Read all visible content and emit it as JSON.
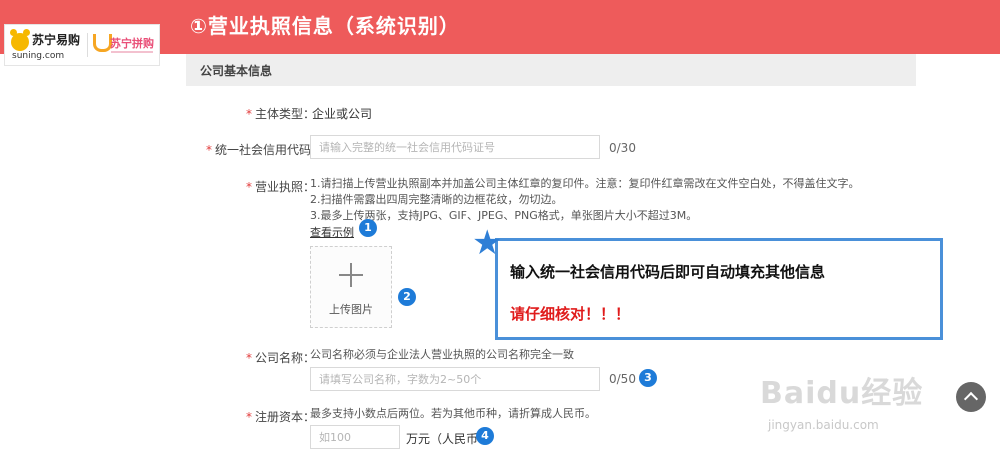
{
  "banner": {
    "title": "①营业执照信息（系统识别）"
  },
  "logos": {
    "suning": "苏宁易购",
    "suning_sub": "suning.com",
    "pinggou": "苏宁拼购"
  },
  "section": {
    "title": "公司基本信息"
  },
  "fields": {
    "entity_type": {
      "label": "主体类型：",
      "value": "企业或公司"
    },
    "credit_code": {
      "label": "统一社会信用代码",
      "placeholder": "请输入完整的统一社会信用代码证号",
      "counter": "0/30"
    },
    "license": {
      "label": "营业执照：",
      "hints": [
        "1.请扫描上传营业执照副本并加盖公司主体红章的复印件。注意：复印件红章需改在文件空白处，不得盖住文字。",
        "2.扫描件需露出四周完整清晰的边框花纹，勿切边。",
        "3.最多上传两张，支持JPG、GIF、JPEG、PNG格式，单张图片大小不超过3M。"
      ],
      "example_link": "查看示例",
      "upload_label": "上传图片"
    },
    "company_name": {
      "label": "公司名称：",
      "hint": "公司名称必须与企业法人营业执照的公司名称完全一致",
      "placeholder": "请填写公司名称，字数为2~50个",
      "counter": "0/50"
    },
    "capital": {
      "label": "注册资本：",
      "hint": "最多支持小数点后两位。若为其他币种，请折算成人民币。",
      "placeholder": "如100",
      "unit": "万元（人民币"
    }
  },
  "badges": [
    "1",
    "2",
    "3",
    "4"
  ],
  "callout": {
    "line1": "输入统一社会信用代码后即可自动填充其他信息",
    "line2": "请仔细核对！！！"
  },
  "watermark": {
    "main": "Baidu经验",
    "sub": "jingyan.baidu.com"
  },
  "colors": {
    "banner": "#ee5b5b",
    "badge": "#1e7bd8",
    "callout_border": "#4a90d9",
    "warning": "#e01b1b"
  }
}
